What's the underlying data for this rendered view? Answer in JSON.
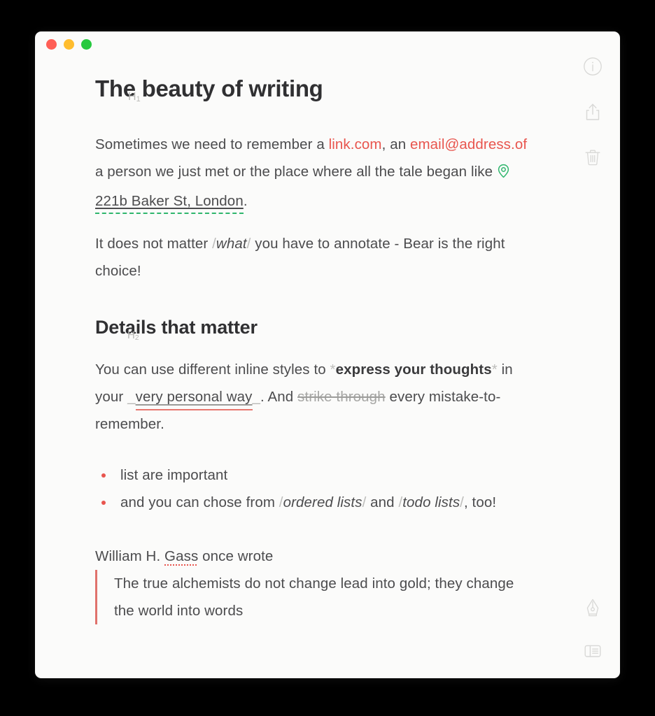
{
  "window": {
    "traffic_lights": [
      {
        "name": "close",
        "color": "#ff5f56"
      },
      {
        "name": "minimize",
        "color": "#ffbd2e"
      },
      {
        "name": "zoom",
        "color": "#27c93f"
      }
    ]
  },
  "rail": {
    "top_icons": [
      {
        "name": "info-icon",
        "label": "Info"
      },
      {
        "name": "share-icon",
        "label": "Share"
      },
      {
        "name": "trash-icon",
        "label": "Delete"
      }
    ],
    "bottom_icons": [
      {
        "name": "pen-nib-icon",
        "label": "Edit"
      },
      {
        "name": "sidebar-panel-icon",
        "label": "Toggle sidebar"
      }
    ]
  },
  "document": {
    "h1_marker": "H",
    "h1_marker_sub": "1",
    "h1": "The beauty of writing",
    "h2_marker": "H",
    "h2_marker_sub": "2",
    "h2": "Details that matter",
    "para1": {
      "t1": "Sometimes we need to remember a ",
      "link": "link.com",
      "t2": ", an ",
      "email": "email@address.of",
      "t3": " a person we just met or the place where all the tale began like ",
      "address": "221b Baker St, London",
      "t4": "."
    },
    "para2": {
      "t1": "It does not matter ",
      "slash_open": "/",
      "italic": "what",
      "slash_close": "/",
      "t2": " you have to annotate - Bear is the right choice!"
    },
    "para3": {
      "t1": "You can use different inline styles to ",
      "star_open": "*",
      "bold": "express your thoughts",
      "star_close": "*",
      "t2": " in your ",
      "u_open": "_",
      "underline": "very personal way",
      "u_close": "_",
      "t3": ". And ",
      "strike": "strike through",
      "t4": " every mistake-to-remember."
    },
    "list": [
      {
        "t1": "list are important"
      },
      {
        "t1": "and you can chose from ",
        "slash1": "/",
        "em1": "ordered lists",
        "slash2": "/",
        "t2": " and ",
        "slash3": "/",
        "em2": "todo lists",
        "slash4": "/",
        "t3": ", too!"
      }
    ],
    "quote_intro": {
      "t1": "William H. ",
      "misspelled": "Gass",
      "t2": " once wrote"
    },
    "quote": "The true alchemists do not change lead into gold; they change the world into words"
  },
  "colors": {
    "accent": "#e8554e",
    "text": "#4c4c4e",
    "heading": "#303032",
    "muted": "#bdbdbb",
    "green": "#2fb66d",
    "background": "#fbfbfa",
    "page_background": "#000000"
  }
}
